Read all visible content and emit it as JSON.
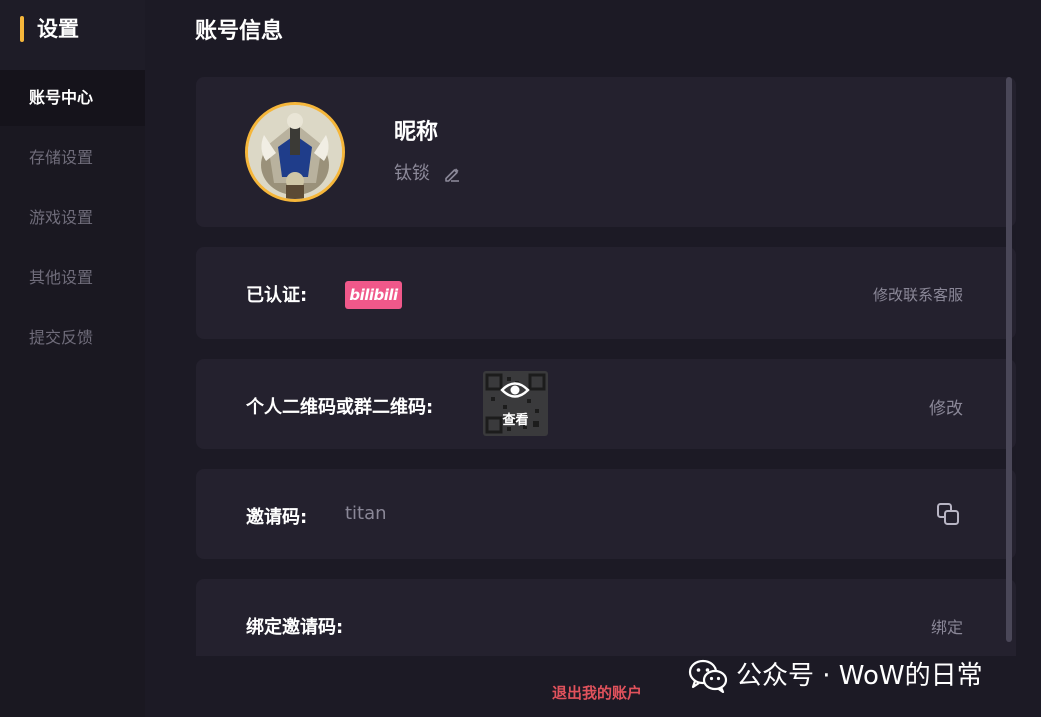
{
  "sidebar": {
    "title": "设置",
    "items": [
      {
        "label": "账号中心",
        "active": true
      },
      {
        "label": "存储设置",
        "active": false
      },
      {
        "label": "游戏设置",
        "active": false
      },
      {
        "label": "其他设置",
        "active": false
      },
      {
        "label": "提交反馈",
        "active": false
      }
    ]
  },
  "main": {
    "title": "账号信息",
    "profile": {
      "nickname_label": "昵称",
      "nickname_value": "钛锬"
    },
    "verified": {
      "label": "已认证:",
      "badge": "bilibili",
      "action": "修改联系客服"
    },
    "qrcode": {
      "label": "个人二维码或群二维码:",
      "view_label": "查看",
      "action": "修改"
    },
    "invite": {
      "label": "邀请码:",
      "value": "titan"
    },
    "bind_invite": {
      "label": "绑定邀请码:",
      "action": "绑定"
    },
    "logout_label": "退出我的账户"
  },
  "watermark": {
    "text": "公众号 · WoW的日常"
  },
  "colors": {
    "accent": "#f5b63a",
    "bilibili": "#f0588a",
    "logout": "#e0525c",
    "background": "#1c1a25",
    "card": "#24212e"
  }
}
